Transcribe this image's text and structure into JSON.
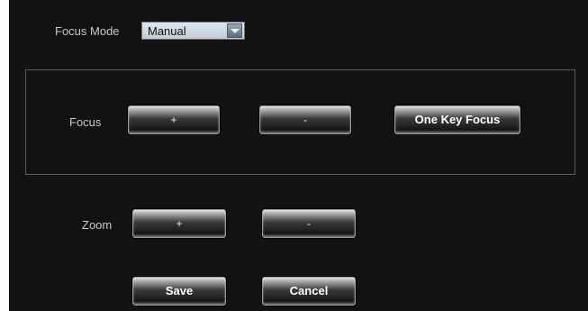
{
  "focus_mode": {
    "label": "Focus Mode",
    "value": "Manual"
  },
  "focus": {
    "label": "Focus",
    "plus": "+",
    "minus": "-",
    "one_key": "One Key Focus"
  },
  "zoom": {
    "label": "Zoom",
    "plus": "+",
    "minus": "-"
  },
  "actions": {
    "save": "Save",
    "cancel": "Cancel"
  }
}
